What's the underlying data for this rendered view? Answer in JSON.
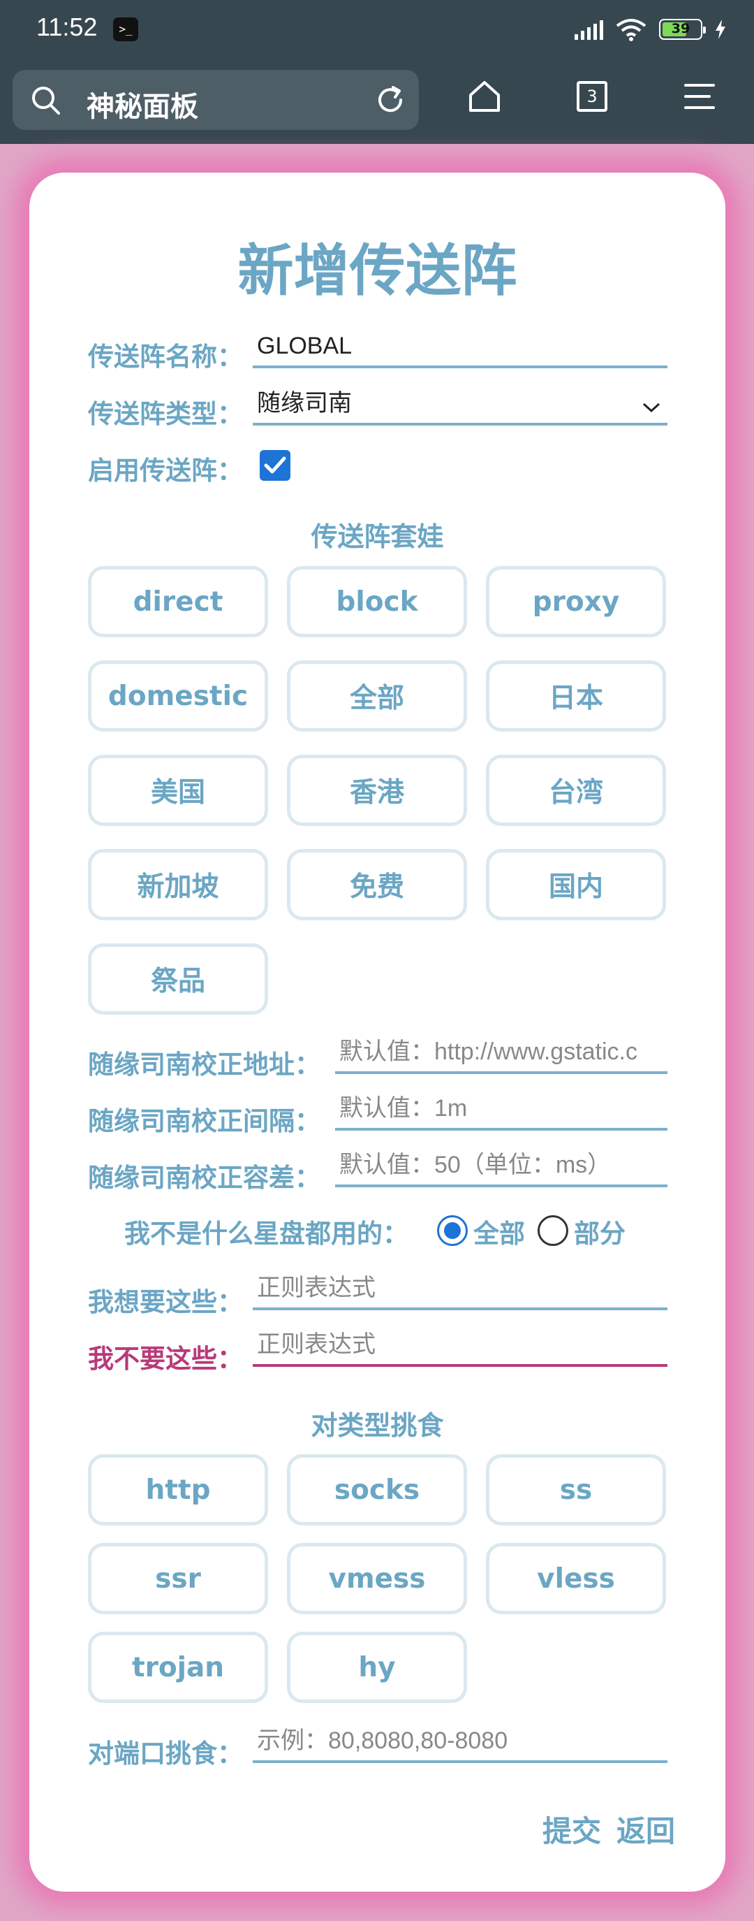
{
  "status": {
    "time": "11:52",
    "battery": "39",
    "terminal_glyph": ">_"
  },
  "toolbar": {
    "title": "神秘面板",
    "tab_count": "3"
  },
  "form": {
    "heading": "新增传送阵",
    "name_label": "传送阵名称：",
    "name_value": "GLOBAL",
    "type_label": "传送阵类型：",
    "type_value": "随缘司南",
    "enable_label": "启用传送阵：",
    "nest_title": "传送阵套娃",
    "nest_chips": [
      "direct",
      "block",
      "proxy",
      "domestic",
      "全部",
      "日本",
      "美国",
      "香港",
      "台湾",
      "新加坡",
      "免费",
      "国内",
      "祭品"
    ],
    "url_label": "随缘司南校正地址：",
    "url_placeholder": "默认值：http://www.gstatic.c",
    "interval_label": "随缘司南校正间隔：",
    "interval_placeholder": "默认值：1m",
    "tolerance_label": "随缘司南校正容差：",
    "tolerance_placeholder": "默认值：50（单位：ms）",
    "scope_label": "我不是什么星盘都用的：",
    "scope_all": "全部",
    "scope_part": "部分",
    "want_label": "我想要这些：",
    "want_placeholder": "正则表达式",
    "dont_label": "我不要这些：",
    "dont_placeholder": "正则表达式",
    "type_title": "对类型挑食",
    "type_chips": [
      "http",
      "socks",
      "ss",
      "ssr",
      "vmess",
      "vless",
      "trojan",
      "hy"
    ],
    "port_label": "对端口挑食：",
    "port_placeholder": "示例：80,8080,80-8080",
    "submit": "提交",
    "back": "返回"
  },
  "colors": {
    "accent": "#6ba6c4",
    "pink": "#b83a7a",
    "checkbox": "#1e73d6",
    "frame": "#e0a6c6"
  }
}
